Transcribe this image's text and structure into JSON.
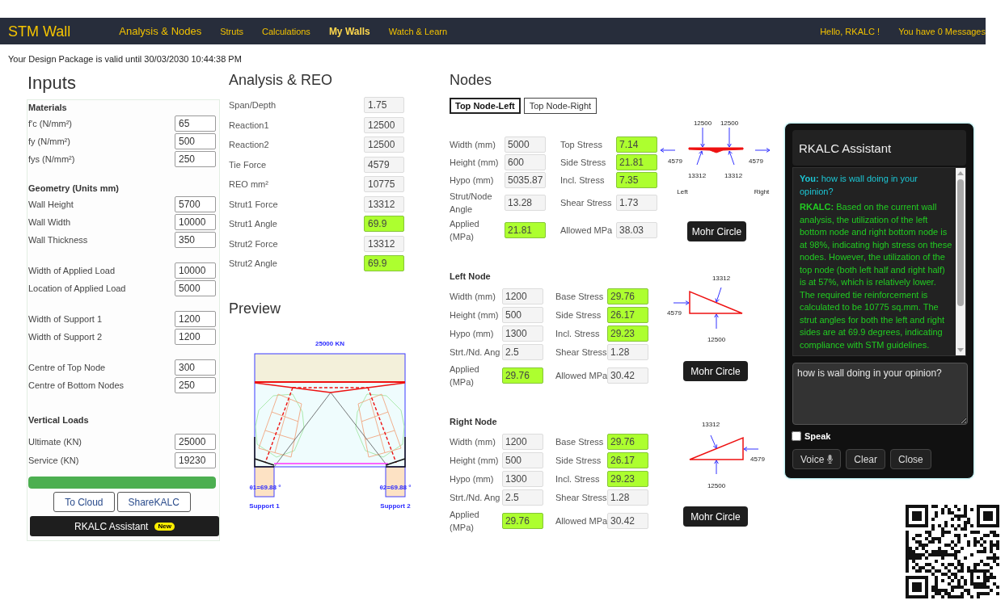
{
  "nav": {
    "brand": "STM Wall",
    "links": [
      {
        "label": "Analysis & Nodes",
        "kind": "primary",
        "selected": false
      },
      {
        "label": "Struts",
        "kind": "secondary",
        "selected": false
      },
      {
        "label": "Calculations",
        "kind": "secondary",
        "selected": false
      },
      {
        "label": "My Walls",
        "kind": "secondary",
        "selected": true
      },
      {
        "label": "Watch & Learn",
        "kind": "secondary",
        "selected": false
      }
    ],
    "greeting": "Hello, RKALC !",
    "messages": "You have 0 Messages"
  },
  "validity": "Your Design Package is valid until 30/03/2030 10:44:38 PM",
  "inputs": {
    "title": "Inputs",
    "groups": [
      {
        "heading": "Materials",
        "fields": [
          {
            "label": "f'c (N/mm²)",
            "value": "65"
          },
          {
            "label": "fy (N/mm²)",
            "value": "500"
          },
          {
            "label": "fys (N/mm²)",
            "value": "250"
          }
        ]
      },
      {
        "heading": "Geometry (Units mm)",
        "fields": [
          {
            "label": "Wall Height",
            "value": "5700"
          },
          {
            "label": "Wall Width",
            "value": "10000"
          },
          {
            "label": "Wall Thickness",
            "value": "350"
          }
        ]
      },
      {
        "fields": [
          {
            "label": "Width of Applied Load",
            "value": "10000"
          },
          {
            "label": "Location of Applied Load",
            "value": "5000"
          }
        ]
      },
      {
        "fields": [
          {
            "label": "Width of Support 1",
            "value": "1200"
          },
          {
            "label": "Width of Support 2",
            "value": "1200"
          }
        ]
      },
      {
        "fields": [
          {
            "label": "Centre of Top Node",
            "value": "300"
          },
          {
            "label": "Centre of Bottom Nodes",
            "value": "250"
          }
        ]
      },
      {
        "heading": "Vertical Loads",
        "fields": [
          {
            "label": "Ultimate (KN)",
            "value": "25000"
          },
          {
            "label": "Service (KN)",
            "value": "19230"
          }
        ]
      }
    ],
    "progress": {
      "level": 1
    },
    "buttons": [
      "To Cloud",
      "ShareKALC"
    ],
    "assistant_button": {
      "label": "RKALC Assistant",
      "badge": "New"
    }
  },
  "analysis": {
    "title": "Analysis & REO",
    "rows": [
      {
        "label": "Span/Depth",
        "value": "1.75",
        "highlighted": false
      },
      {
        "label": "Reaction1",
        "value": "12500",
        "highlighted": false
      },
      {
        "label": "Reaction2",
        "value": "12500",
        "highlighted": false
      },
      {
        "label": "Tie Force",
        "value": "4579",
        "highlighted": false
      },
      {
        "label": "REO mm²",
        "value": "10775",
        "highlighted": false
      },
      {
        "label": "Strut1 Force",
        "value": "13312",
        "highlighted": false
      },
      {
        "label": "Strut1 Angle",
        "value": "69.9",
        "highlighted": true
      },
      {
        "label": "Strut2 Force",
        "value": "13312",
        "highlighted": false
      },
      {
        "label": "Strut2 Angle",
        "value": "69.9",
        "highlighted": true
      }
    ]
  },
  "preview": {
    "title": "Preview",
    "load_label": "25000 KN",
    "angle_labels": [
      "θ1=69.88 °",
      "θ2=69.88 °"
    ],
    "support_labels": [
      "Support 1",
      "Support 2"
    ]
  },
  "nodes": {
    "title": "Nodes",
    "tabs": [
      {
        "label": "Top Node-Left",
        "selected": true
      },
      {
        "label": "Top Node-Right",
        "selected": false
      }
    ],
    "sections": [
      {
        "kind": "top",
        "rows": [
          {
            "left": {
              "label": "Width (mm)",
              "value": "5000",
              "highlighted": false
            },
            "right": {
              "label": "Top Stress",
              "value": "7.14",
              "highlighted": true
            }
          },
          {
            "left": {
              "label": "Height (mm)",
              "value": "600",
              "highlighted": false
            },
            "right": {
              "label": "Side Stress",
              "value": "21.81",
              "highlighted": true
            }
          },
          {
            "left": {
              "label": "Hypo (mm)",
              "value": "5035.87",
              "highlighted": false
            },
            "right": {
              "label": "Incl. Stress",
              "value": "7.35",
              "highlighted": true
            }
          },
          {
            "left": {
              "label": "Strut/Node Angle",
              "value": "13.28",
              "highlighted": false
            },
            "right": {
              "label": "Shear Stress",
              "value": "1.73",
              "highlighted": false
            }
          },
          {
            "left": {
              "label": "Applied (MPa)",
              "value": "21.81",
              "highlighted": true
            },
            "right": {
              "label": "Allowed MPa",
              "value": "38.03",
              "highlighted": false
            }
          }
        ],
        "diagram": {
          "loads": [
            "12500",
            "12500"
          ],
          "ties": [
            "4579",
            "4579"
          ],
          "struts": [
            "13312",
            "13312"
          ],
          "sides": [
            "Left",
            "Right"
          ]
        },
        "button": "Mohr Circle"
      },
      {
        "kind": "left",
        "heading": "Left Node",
        "rows": [
          {
            "left": {
              "label": "Width (mm)",
              "value": "1200",
              "highlighted": false
            },
            "right": {
              "label": "Base Stress",
              "value": "29.76",
              "highlighted": true
            }
          },
          {
            "left": {
              "label": "Height (mm)",
              "value": "500",
              "highlighted": false
            },
            "right": {
              "label": "Side Stress",
              "value": "26.17",
              "highlighted": true
            }
          },
          {
            "left": {
              "label": "Hypo (mm)",
              "value": "1300",
              "highlighted": false
            },
            "right": {
              "label": "Incl. Stress",
              "value": "29.23",
              "highlighted": true
            }
          },
          {
            "left": {
              "label": "Strt./Nd. Ang",
              "value": "2.5",
              "highlighted": false
            },
            "right": {
              "label": "Shear Stress",
              "value": "1.28",
              "highlighted": false
            }
          },
          {
            "left": {
              "label": "Applied (MPa)",
              "value": "29.76",
              "highlighted": true
            },
            "right": {
              "label": "Allowed MPa",
              "value": "30.42",
              "highlighted": false
            }
          }
        ],
        "diagram": {
          "strut": "13312",
          "tie": "4579",
          "reaction": "12500"
        },
        "button": "Mohr Circle"
      },
      {
        "kind": "right",
        "heading": "Right Node",
        "rows": [
          {
            "left": {
              "label": "Width (mm)",
              "value": "1200",
              "highlighted": false
            },
            "right": {
              "label": "Base Stress",
              "value": "29.76",
              "highlighted": true
            }
          },
          {
            "left": {
              "label": "Height (mm)",
              "value": "500",
              "highlighted": false
            },
            "right": {
              "label": "Side Stress",
              "value": "26.17",
              "highlighted": true
            }
          },
          {
            "left": {
              "label": "Hypo (mm)",
              "value": "1300",
              "highlighted": false
            },
            "right": {
              "label": "Incl. Stress",
              "value": "29.23",
              "highlighted": true
            }
          },
          {
            "left": {
              "label": "Strt./Nd. Ang",
              "value": "2.5",
              "highlighted": false
            },
            "right": {
              "label": "Shear Stress",
              "value": "1.28",
              "highlighted": false
            }
          },
          {
            "left": {
              "label": "Applied (MPa)",
              "value": "29.76",
              "highlighted": true
            },
            "right": {
              "label": "Allowed MPa",
              "value": "30.42",
              "highlighted": false
            }
          }
        ],
        "diagram": {
          "strut": "13312",
          "tie": "4579",
          "reaction": "12500"
        },
        "button": "Mohr Circle"
      }
    ]
  },
  "assistant": {
    "title": "RKALC Assistant",
    "messages": [
      {
        "kind": "user",
        "sender": "You:",
        "text": "how is wall doing in your opinion?"
      },
      {
        "kind": "bot",
        "sender": "RKALC:",
        "text": "Based on the current wall analysis, the utilization of the left bottom node and right bottom node is at 98%, indicating high stress on these nodes. However, the utilization of the top node (both left half and right half) is at 57%, which is relatively lower. The required tie reinforcement is calculated to be 10775 sq.mm. The strut angles for both the left and right sides are at 69.9 degrees, indicating compliance with STM guidelines."
      }
    ],
    "input_value": "how is wall doing in your opinion?",
    "speak": {
      "label": "Speak",
      "checked": false
    },
    "buttons": [
      {
        "label": "Voice",
        "kind": "voice"
      },
      {
        "label": "Clear",
        "kind": "clear"
      },
      {
        "label": "Close",
        "kind": "close"
      }
    ]
  }
}
